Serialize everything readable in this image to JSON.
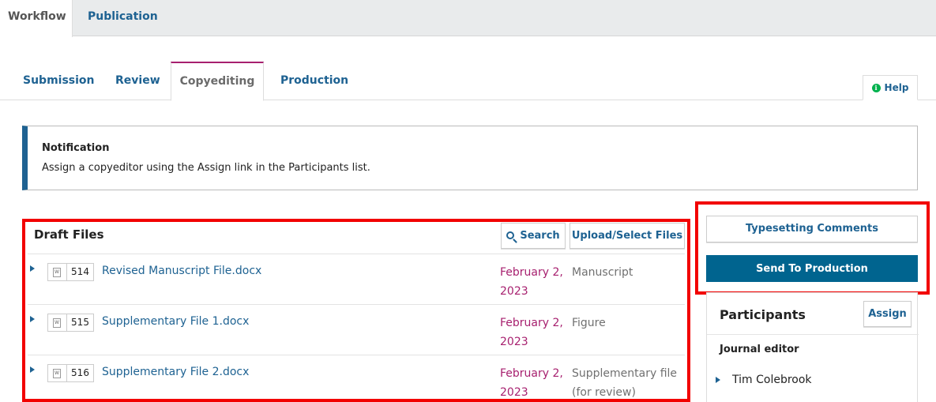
{
  "top_tabs": {
    "workflow": "Workflow",
    "publication": "Publication"
  },
  "stage_tabs": {
    "submission": "Submission",
    "review": "Review",
    "copyediting": "Copyediting",
    "production": "Production"
  },
  "help": {
    "label": "Help",
    "icon": "info-icon"
  },
  "notification": {
    "title": "Notification",
    "body": "Assign a copyeditor using the Assign link in the Participants list."
  },
  "draft_files": {
    "title": "Draft Files",
    "search_label": "Search",
    "upload_label": "Upload/Select Files",
    "files": [
      {
        "id": "514",
        "name": "Revised Manuscript File.docx",
        "date": "February 2, 2023",
        "type": "Manuscript"
      },
      {
        "id": "515",
        "name": "Supplementary File 1.docx",
        "date": "February 2, 2023",
        "type": "Figure"
      },
      {
        "id": "516",
        "name": "Supplementary File 2.docx",
        "date": "February 2, 2023",
        "type": "Supplementary file (for review)"
      }
    ]
  },
  "actions": {
    "typesetting_comments": "Typesetting Comments",
    "send_to_production": "Send To Production"
  },
  "participants": {
    "title": "Participants",
    "assign_label": "Assign",
    "role": "Journal editor",
    "members": [
      "Tim Colebrook"
    ]
  },
  "colors": {
    "link": "#1e6292",
    "accent": "#a7206f",
    "primary_button": "#00648f",
    "highlight_box": "#f20000",
    "help_icon": "#00b24e"
  }
}
